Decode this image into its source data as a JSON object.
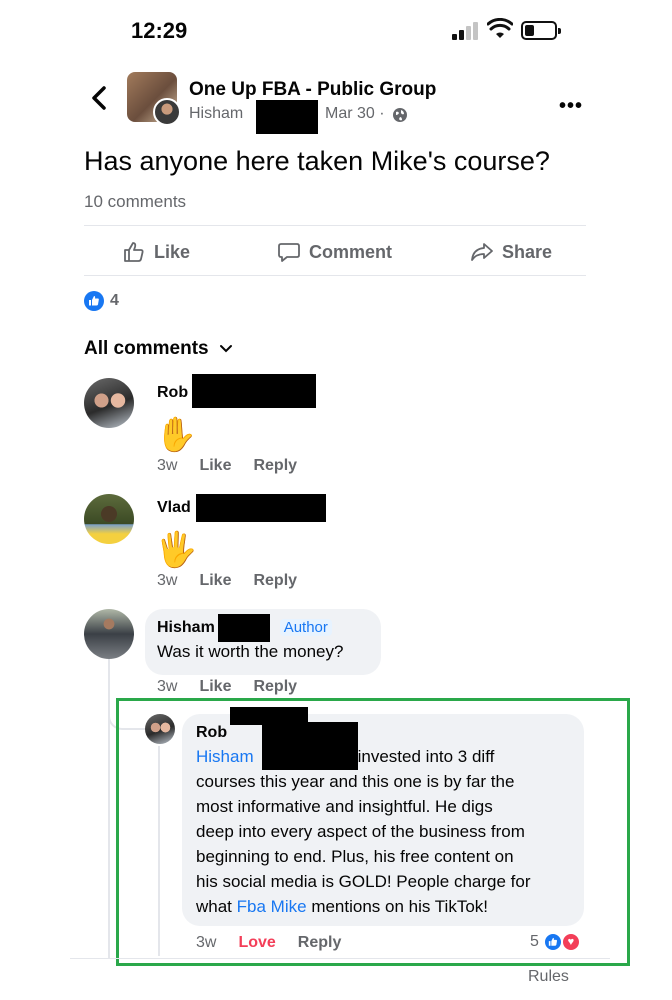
{
  "status_bar": {
    "time": "12:29"
  },
  "header": {
    "group_name": "One Up FBA - Public Group",
    "poster_name": "Hisham",
    "poster_suffix": "",
    "date": "Mar 30 ·"
  },
  "post": {
    "text": "Has anyone here taken Mike's course?",
    "comment_count": "10 comments",
    "reaction_count": "4"
  },
  "actions": {
    "like": "Like",
    "comment": "Comment",
    "share": "Share"
  },
  "comments_header": "All comments",
  "comments": [
    {
      "name": "Rob",
      "emoji": "✋",
      "time": "3w",
      "like": "Like",
      "reply": "Reply"
    },
    {
      "name": "Vlad",
      "emoji": "🖐",
      "time": "3w",
      "like": "Like",
      "reply": "Reply"
    },
    {
      "name": "Hisham",
      "badge": "Author",
      "text": "Was it worth the money?",
      "time": "3w",
      "like": "Like",
      "reply": "Reply"
    }
  ],
  "reply": {
    "name": "Rob",
    "mention1": "Hisham",
    "line1_rest": "invested into 3 diff",
    "line2": "courses this year and this one is by far the",
    "line3": "most informative and insightful. He digs",
    "line4": "deep into every aspect of the business from",
    "line5": "beginning to end. Plus, his free content on",
    "line6": "his social media is GOLD! People charge for",
    "line7_pre": "what",
    "mention2": "Fba Mike",
    "line7_post": "mentions on his TikTok!",
    "time": "3w",
    "love": "Love",
    "reply_label": "Reply",
    "reaction_count": "5"
  },
  "footer": {
    "rules": "Rules"
  },
  "colors": {
    "accent": "#1877f2",
    "love": "#f33e58",
    "highlight": "#2aa84a"
  }
}
